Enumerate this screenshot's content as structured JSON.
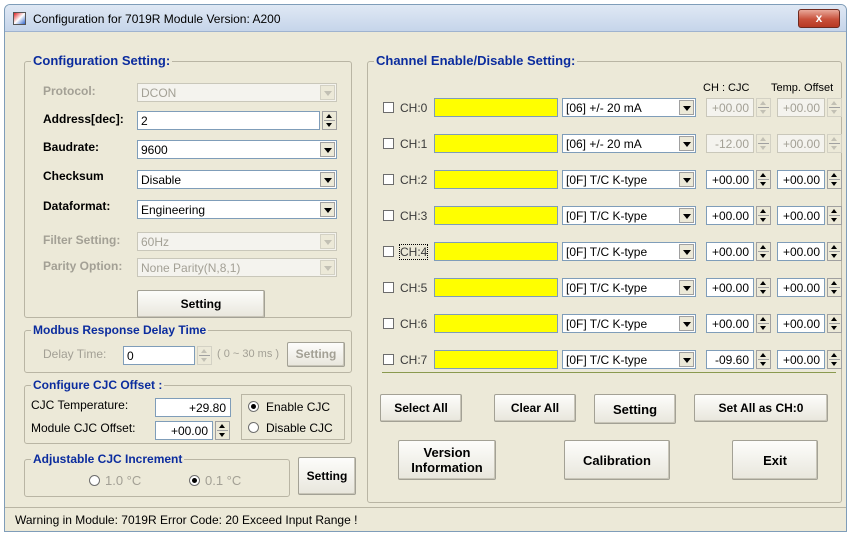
{
  "window": {
    "title": "Configuration for 7019R Module Version: A200",
    "close_glyph": "x"
  },
  "config": {
    "legend": "Configuration Setting:",
    "protocol": {
      "label": "Protocol:",
      "value": "DCON"
    },
    "address": {
      "label": "Address[dec]:",
      "value": "2"
    },
    "baudrate": {
      "label": "Baudrate:",
      "value": "9600"
    },
    "checksum": {
      "label": "Checksum",
      "value": "Disable"
    },
    "dataformat": {
      "label": "Dataformat:",
      "value": "Engineering"
    },
    "filter": {
      "label": "Filter Setting:",
      "value": "60Hz"
    },
    "parity": {
      "label": "Parity Option:",
      "value": "None Parity(N,8,1)"
    },
    "setting_button": "Setting"
  },
  "modbus": {
    "legend": "Modbus Response Delay Time",
    "delay_label": "Delay Time:",
    "delay_value": "0",
    "range": "( 0 ~ 30 ms )",
    "setting_button": "Setting"
  },
  "cjc": {
    "legend": "Configure CJC Offset :",
    "temp_label": "CJC Temperature:",
    "temp_value": "+29.80",
    "offset_label": "Module CJC Offset:",
    "offset_value": "+00.00",
    "enable_label": "Enable CJC",
    "disable_label": "Disable CJC"
  },
  "increment": {
    "legend": "Adjustable CJC Increment",
    "opt1": "1.0 °C",
    "opt2": "0.1 °C",
    "setting_button": "Setting"
  },
  "channels": {
    "legend": "Channel Enable/Disable Setting:",
    "cjc_header": "CH : CJC",
    "offset_header": "Temp. Offset",
    "list": [
      {
        "name": "CH:0",
        "range": "[06] +/- 20 mA",
        "cjc": "+00.00",
        "offset": "+00.00"
      },
      {
        "name": "CH:1",
        "range": "[06] +/- 20 mA",
        "cjc": "-12.00",
        "offset": "+00.00"
      },
      {
        "name": "CH:2",
        "range": "[0F] T/C K-type",
        "cjc": "+00.00",
        "offset": "+00.00"
      },
      {
        "name": "CH:3",
        "range": "[0F] T/C K-type",
        "cjc": "+00.00",
        "offset": "+00.00"
      },
      {
        "name": "CH:4",
        "range": "[0F] T/C K-type",
        "cjc": "+00.00",
        "offset": "+00.00"
      },
      {
        "name": "CH:5",
        "range": "[0F] T/C K-type",
        "cjc": "+00.00",
        "offset": "+00.00"
      },
      {
        "name": "CH:6",
        "range": "[0F] T/C K-type",
        "cjc": "+00.00",
        "offset": "+00.00"
      },
      {
        "name": "CH:7",
        "range": "[0F] T/C K-type",
        "cjc": "-09.60",
        "offset": "+00.00"
      }
    ],
    "select_all": "Select All",
    "clear_all": "Clear All",
    "setting": "Setting",
    "set_all": "Set All as CH:0"
  },
  "actions": {
    "version_line1": "Version",
    "version_line2": "Information",
    "calibration": "Calibration",
    "exit": "Exit"
  },
  "status": {
    "text": "Warning in Module: 7019R  Error Code:  20    Exceed Input Range !"
  },
  "colors": {
    "legend": "#0b2c9e",
    "channel_field": "#ffff00",
    "window_bg": "#ece9d8"
  }
}
